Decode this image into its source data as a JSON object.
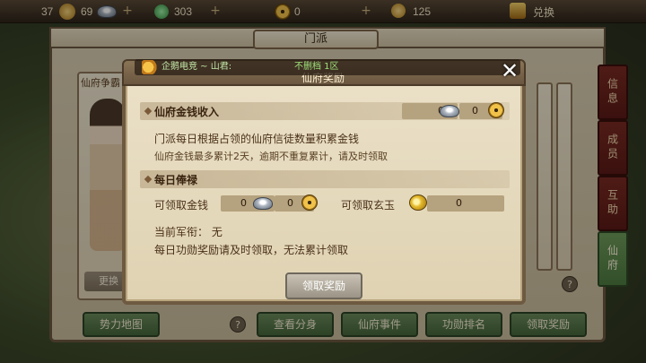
{
  "topbar": {
    "res1": "37",
    "res2": "69",
    "res3": "303",
    "res4": "0",
    "res5": "125",
    "exchange": "兑换"
  },
  "background": {
    "panel_title": "门派",
    "left_card_title": "仙府争霸",
    "left_card_button": "更换",
    "side_tabs": [
      "信息",
      "成员",
      "互助",
      "仙府"
    ],
    "bottom_buttons": [
      "势力地图",
      "查看分身",
      "仙府事件",
      "功勋排名",
      "领取奖励"
    ],
    "help": "?"
  },
  "notification": {
    "left_text": "企鹅电竞 ~ 山君:",
    "mid_text": "不删档 1区"
  },
  "modal": {
    "title": "仙府奖励",
    "close": "✕",
    "income": {
      "title": "仙府金钱收入",
      "silver_value": "0",
      "gold_value": "0",
      "desc1": "门派每日根据占领的仙府信徒数量积累金钱",
      "desc2": "仙府金钱最多累计2天，逾期不重复累计，请及时领取"
    },
    "salary": {
      "title": "每日俸禄",
      "money_label": "可领取金钱",
      "money_silver": "0",
      "money_gold": "0",
      "jade_label": "可领取玄玉",
      "jade_value": "0",
      "rank_label": "当前军衔：",
      "rank_value": "无",
      "note": "每日功勋奖励请及时领取，无法累计领取"
    },
    "claim_button": "领取奖励"
  },
  "colors": {
    "side_tab_active": "#4d7a40",
    "side_tab": "#6a2018",
    "bottom_button": "#45663a"
  },
  "icons": [
    "silver-ingot-icon",
    "gold-coin-icon",
    "jade-icon",
    "speaker-icon",
    "close-icon",
    "gem-icon"
  ]
}
